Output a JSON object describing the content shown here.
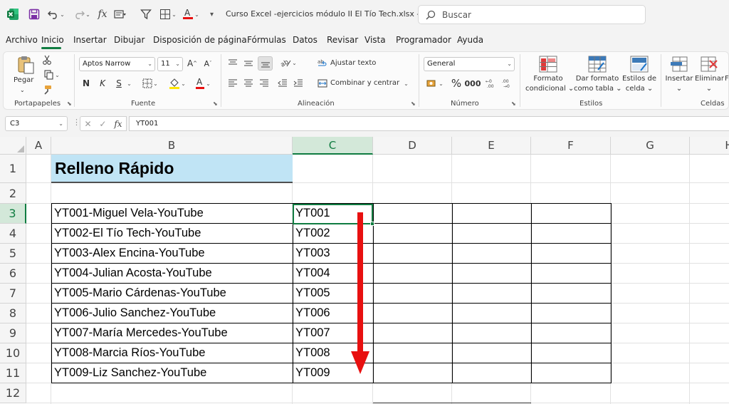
{
  "title_bar": {
    "doc_title": "Curso Excel -ejercicios módulo II El Tío Tech.xlsx  -...",
    "search_placeholder": "Buscar"
  },
  "menu_tabs": [
    "Archivo",
    "Inicio",
    "Insertar",
    "Dibujar",
    "Disposición de página",
    "Fórmulas",
    "Datos",
    "Revisar",
    "Vista",
    "Programador",
    "Ayuda"
  ],
  "active_tab": "Inicio",
  "ribbon": {
    "clipboard": {
      "paste_label": "Pegar",
      "group_label": "Portapapeles"
    },
    "font": {
      "font_name": "Aptos Narrow",
      "font_size": "11",
      "bold": "N",
      "italic": "K",
      "underline": "S",
      "group_label": "Fuente"
    },
    "alignment": {
      "wrap_text": "Ajustar texto",
      "merge_center": "Combinar y centrar",
      "group_label": "Alineación"
    },
    "number": {
      "format": "General",
      "group_label": "Número"
    },
    "styles": {
      "conditional_format_line1": "Formato",
      "conditional_format_line2": "condicional",
      "format_as_table_line1": "Dar formato",
      "format_as_table_line2": "como tabla",
      "cell_styles_line1": "Estilos de",
      "cell_styles_line2": "celda",
      "group_label": "Estilos"
    },
    "cells": {
      "insert": "Insertar",
      "delete": "Eliminar",
      "group_label": "Celdas"
    }
  },
  "formula_bar": {
    "name_box": "C3",
    "fx": "fx",
    "content": "YT001"
  },
  "sheet": {
    "columns": [
      "A",
      "B",
      "C",
      "D",
      "E",
      "F",
      "G",
      "H"
    ],
    "rows": [
      "1",
      "2",
      "3",
      "4",
      "5",
      "6",
      "7",
      "8",
      "9",
      "10",
      "11",
      "12"
    ],
    "selected_column": "C",
    "selected_row": "3",
    "title": "Relleno Rápido",
    "table_rows": [
      {
        "b": "YT001-Miguel Vela-YouTube",
        "c": "YT001"
      },
      {
        "b": "YT002-El Tío Tech-YouTube",
        "c": "YT002"
      },
      {
        "b": "YT003-Alex Encina-YouTube",
        "c": "YT003"
      },
      {
        "b": "YT004-Julian Acosta-YouTube",
        "c": "YT004"
      },
      {
        "b": "YT005-Mario Cárdenas-YouTube",
        "c": "YT005"
      },
      {
        "b": "YT006-Julio Sanchez-YouTube",
        "c": "YT006"
      },
      {
        "b": "YT007-María Mercedes-YouTube",
        "c": "YT007"
      },
      {
        "b": "YT008-Marcia Ríos-YouTube",
        "c": "YT008"
      },
      {
        "b": "YT009-Liz Sanchez-YouTube",
        "c": "YT009"
      }
    ]
  },
  "colors": {
    "excel_green": "#107c41",
    "title_fill": "#c0e4f5",
    "arrow_red": "#e81010"
  }
}
